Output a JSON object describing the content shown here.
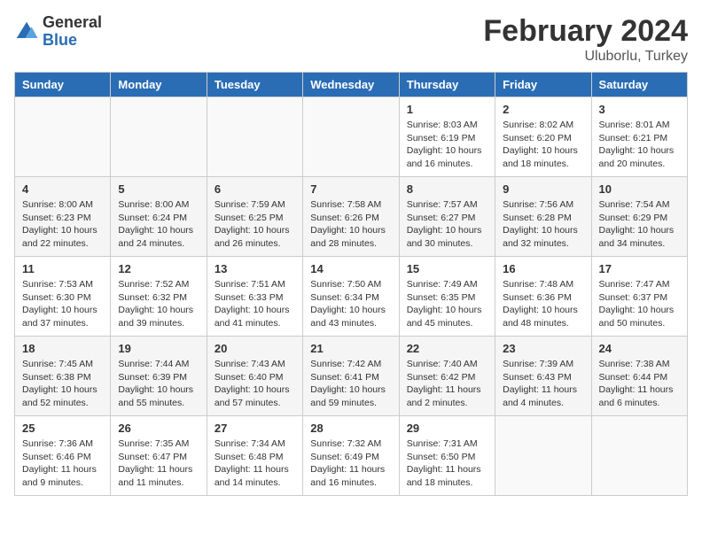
{
  "logo": {
    "general": "General",
    "blue": "Blue"
  },
  "title": "February 2024",
  "location": "Uluborlu, Turkey",
  "days_of_week": [
    "Sunday",
    "Monday",
    "Tuesday",
    "Wednesday",
    "Thursday",
    "Friday",
    "Saturday"
  ],
  "weeks": [
    [
      {
        "day": "",
        "detail": ""
      },
      {
        "day": "",
        "detail": ""
      },
      {
        "day": "",
        "detail": ""
      },
      {
        "day": "",
        "detail": ""
      },
      {
        "day": "1",
        "detail": "Sunrise: 8:03 AM\nSunset: 6:19 PM\nDaylight: 10 hours\nand 16 minutes."
      },
      {
        "day": "2",
        "detail": "Sunrise: 8:02 AM\nSunset: 6:20 PM\nDaylight: 10 hours\nand 18 minutes."
      },
      {
        "day": "3",
        "detail": "Sunrise: 8:01 AM\nSunset: 6:21 PM\nDaylight: 10 hours\nand 20 minutes."
      }
    ],
    [
      {
        "day": "4",
        "detail": "Sunrise: 8:00 AM\nSunset: 6:23 PM\nDaylight: 10 hours\nand 22 minutes."
      },
      {
        "day": "5",
        "detail": "Sunrise: 8:00 AM\nSunset: 6:24 PM\nDaylight: 10 hours\nand 24 minutes."
      },
      {
        "day": "6",
        "detail": "Sunrise: 7:59 AM\nSunset: 6:25 PM\nDaylight: 10 hours\nand 26 minutes."
      },
      {
        "day": "7",
        "detail": "Sunrise: 7:58 AM\nSunset: 6:26 PM\nDaylight: 10 hours\nand 28 minutes."
      },
      {
        "day": "8",
        "detail": "Sunrise: 7:57 AM\nSunset: 6:27 PM\nDaylight: 10 hours\nand 30 minutes."
      },
      {
        "day": "9",
        "detail": "Sunrise: 7:56 AM\nSunset: 6:28 PM\nDaylight: 10 hours\nand 32 minutes."
      },
      {
        "day": "10",
        "detail": "Sunrise: 7:54 AM\nSunset: 6:29 PM\nDaylight: 10 hours\nand 34 minutes."
      }
    ],
    [
      {
        "day": "11",
        "detail": "Sunrise: 7:53 AM\nSunset: 6:30 PM\nDaylight: 10 hours\nand 37 minutes."
      },
      {
        "day": "12",
        "detail": "Sunrise: 7:52 AM\nSunset: 6:32 PM\nDaylight: 10 hours\nand 39 minutes."
      },
      {
        "day": "13",
        "detail": "Sunrise: 7:51 AM\nSunset: 6:33 PM\nDaylight: 10 hours\nand 41 minutes."
      },
      {
        "day": "14",
        "detail": "Sunrise: 7:50 AM\nSunset: 6:34 PM\nDaylight: 10 hours\nand 43 minutes."
      },
      {
        "day": "15",
        "detail": "Sunrise: 7:49 AM\nSunset: 6:35 PM\nDaylight: 10 hours\nand 45 minutes."
      },
      {
        "day": "16",
        "detail": "Sunrise: 7:48 AM\nSunset: 6:36 PM\nDaylight: 10 hours\nand 48 minutes."
      },
      {
        "day": "17",
        "detail": "Sunrise: 7:47 AM\nSunset: 6:37 PM\nDaylight: 10 hours\nand 50 minutes."
      }
    ],
    [
      {
        "day": "18",
        "detail": "Sunrise: 7:45 AM\nSunset: 6:38 PM\nDaylight: 10 hours\nand 52 minutes."
      },
      {
        "day": "19",
        "detail": "Sunrise: 7:44 AM\nSunset: 6:39 PM\nDaylight: 10 hours\nand 55 minutes."
      },
      {
        "day": "20",
        "detail": "Sunrise: 7:43 AM\nSunset: 6:40 PM\nDaylight: 10 hours\nand 57 minutes."
      },
      {
        "day": "21",
        "detail": "Sunrise: 7:42 AM\nSunset: 6:41 PM\nDaylight: 10 hours\nand 59 minutes."
      },
      {
        "day": "22",
        "detail": "Sunrise: 7:40 AM\nSunset: 6:42 PM\nDaylight: 11 hours\nand 2 minutes."
      },
      {
        "day": "23",
        "detail": "Sunrise: 7:39 AM\nSunset: 6:43 PM\nDaylight: 11 hours\nand 4 minutes."
      },
      {
        "day": "24",
        "detail": "Sunrise: 7:38 AM\nSunset: 6:44 PM\nDaylight: 11 hours\nand 6 minutes."
      }
    ],
    [
      {
        "day": "25",
        "detail": "Sunrise: 7:36 AM\nSunset: 6:46 PM\nDaylight: 11 hours\nand 9 minutes."
      },
      {
        "day": "26",
        "detail": "Sunrise: 7:35 AM\nSunset: 6:47 PM\nDaylight: 11 hours\nand 11 minutes."
      },
      {
        "day": "27",
        "detail": "Sunrise: 7:34 AM\nSunset: 6:48 PM\nDaylight: 11 hours\nand 14 minutes."
      },
      {
        "day": "28",
        "detail": "Sunrise: 7:32 AM\nSunset: 6:49 PM\nDaylight: 11 hours\nand 16 minutes."
      },
      {
        "day": "29",
        "detail": "Sunrise: 7:31 AM\nSunset: 6:50 PM\nDaylight: 11 hours\nand 18 minutes."
      },
      {
        "day": "",
        "detail": ""
      },
      {
        "day": "",
        "detail": ""
      }
    ]
  ]
}
